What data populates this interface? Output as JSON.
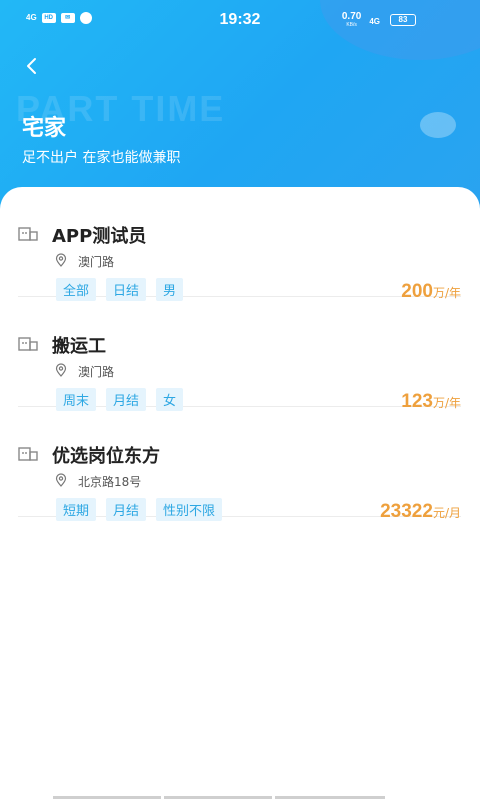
{
  "status_bar": {
    "time": "19:32",
    "signal": "4G",
    "hd": "HD",
    "speed": "0.70",
    "speed_unit": "KB/s",
    "network": "4G",
    "battery": "83"
  },
  "header": {
    "watermark": "PART TIME",
    "title": "宅家",
    "subtitle": "足不出户 在家也能做兼职"
  },
  "jobs": [
    {
      "title": "APP测试员",
      "location": "澳门路",
      "tags": [
        "全部",
        "日结",
        "男"
      ],
      "salary_value": "200",
      "salary_unit": "万/年"
    },
    {
      "title": "搬运工",
      "location": "澳门路",
      "tags": [
        "周末",
        "月结",
        "女"
      ],
      "salary_value": "123",
      "salary_unit": "万/年"
    },
    {
      "title": "优选岗位东方",
      "location": "北京路18号",
      "tags": [
        "短期",
        "月结",
        "性别不限"
      ],
      "salary_value": "23322",
      "salary_unit": "元/月"
    }
  ],
  "icons": {
    "back": "back-arrow-icon",
    "building": "building-icon",
    "location": "location-pin-icon"
  },
  "colors": {
    "header_gradient_start": "#22b8f6",
    "header_gradient_end": "#2aa3f0",
    "tag_bg": "#e5f4fd",
    "tag_text": "#2da7e3",
    "salary": "#eea03d"
  }
}
